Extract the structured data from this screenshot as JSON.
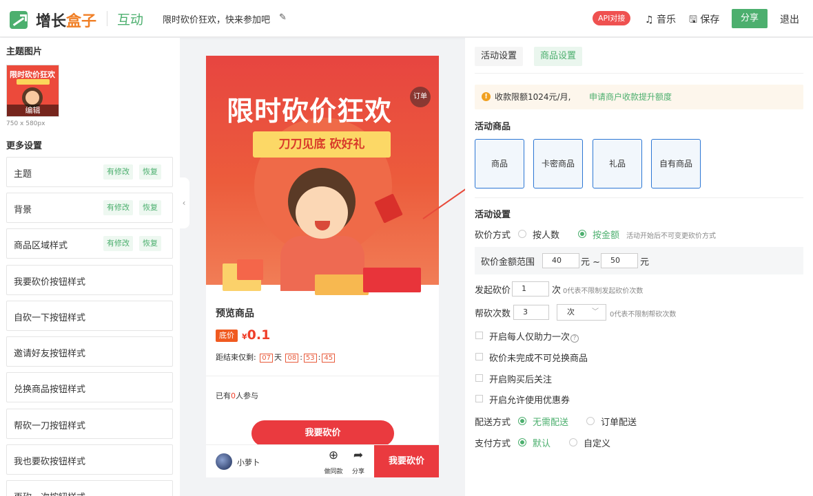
{
  "header": {
    "logo_part1": "增长",
    "logo_part2": "盒子",
    "app_name": "互动",
    "event_title": "限时砍价狂欢，快来参加吧",
    "api_badge": "API对接",
    "music": "音乐",
    "save": "保存",
    "share": "分享",
    "exit": "退出",
    "colors": {
      "brand": "#4caf6e",
      "logo_accent": "#f07f26",
      "badge": "#ef5150"
    }
  },
  "left": {
    "theme_title": "主题图片",
    "thumb_title": "限时砍价狂欢",
    "thumb_edit": "编辑",
    "theme_size": "750 x 580px",
    "more_title": "更多设置",
    "modified_label": "有修改",
    "restore_label": "恢复",
    "items": [
      {
        "label": "主题"
      },
      {
        "label": "背景"
      },
      {
        "label": "商品区域样式"
      },
      {
        "label": "我要砍价按钮样式"
      },
      {
        "label": "自砍一下按钮样式"
      },
      {
        "label": "邀请好友按钮样式"
      },
      {
        "label": "兑换商品按钮样式"
      },
      {
        "label": "帮砍一刀按钮样式"
      },
      {
        "label": "我也要砍按钮样式"
      },
      {
        "label": "再砍一次按钮样式"
      }
    ]
  },
  "preview": {
    "poster_title": "限时砍价狂欢",
    "poster_banner": "刀刀见底 砍好礼",
    "order_badge": "订单",
    "product_name": "预览商品",
    "floor_tag": "底价",
    "price_symbol": "¥",
    "price": "0.1",
    "countdown_label": "距结束仅剩:",
    "cd_days": "07",
    "cd_day_unit": "天",
    "cd_hours": "08",
    "cd_minutes": "53",
    "cd_seconds": "45",
    "cd_sep": ":",
    "participants_prefix": "已有",
    "participants_count": "0",
    "participants_suffix": "人参与",
    "cut_button": "我要砍价",
    "username": "小萝卜",
    "same_label": "做同款",
    "share_label": "分享",
    "bar_cut_button": "我要砍价"
  },
  "right": {
    "tabs": [
      {
        "label": "活动设置"
      },
      {
        "label": "商品设置"
      }
    ],
    "notice_text": "收款限额1024元/月,",
    "notice_link": "申请商户收款提升额度",
    "goods_title": "活动商品",
    "goods_types": [
      {
        "label": "商品"
      },
      {
        "label": "卡密商品"
      },
      {
        "label": "礼品"
      },
      {
        "label": "自有商品"
      }
    ],
    "settings_title": "活动设置",
    "cut_mode_label": "砍价方式",
    "cut_mode_opt1": "按人数",
    "cut_mode_opt2": "按金额",
    "cut_mode_hint": "活动开始后不可变更砍价方式",
    "range_label": "砍价金额范围",
    "range_min": "40",
    "range_unit1": "元 ~",
    "range_max": "50",
    "range_unit2": "元",
    "start_label": "发起砍价",
    "start_value": "1",
    "start_unit": "次",
    "start_hint": "0代表不限制发起砍价次数",
    "help_label": "帮砍次数",
    "help_value": "3",
    "help_unit": "次",
    "help_hint": "0代表不限制帮砍次数",
    "checkboxes": [
      {
        "label": "开启每人仅助力一次"
      },
      {
        "label": "砍价未完成不可兑换商品"
      },
      {
        "label": "开启购买后关注"
      },
      {
        "label": "开启允许使用优惠券"
      }
    ],
    "help_qmark": "?",
    "delivery_label": "配送方式",
    "delivery_opt1": "无需配送",
    "delivery_opt2": "订单配送",
    "payment_label": "支付方式",
    "payment_opt1": "默认",
    "payment_opt2": "自定义"
  }
}
